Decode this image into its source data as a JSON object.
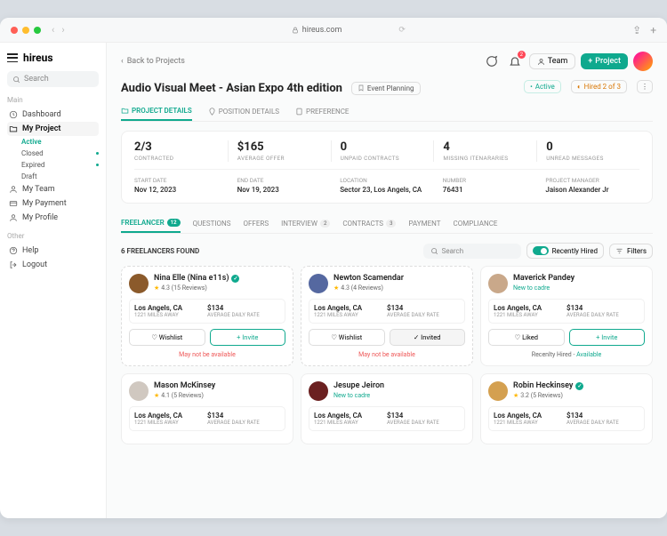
{
  "browser": {
    "url": "hireus.com"
  },
  "brand": "hireus",
  "search_placeholder": "Search",
  "nav": {
    "main_label": "Main",
    "dashboard": "Dashboard",
    "my_project": "My Project",
    "sub": {
      "active": "Active",
      "closed": "Closed",
      "expired": "Expired",
      "draft": "Draft"
    },
    "my_team": "My Team",
    "my_payment": "My Payment",
    "my_profile": "My Profile",
    "other_label": "Other",
    "help": "Help",
    "logout": "Logout"
  },
  "top": {
    "back": "Back to Projects",
    "team": "Team",
    "project": "Project",
    "notif": "2"
  },
  "project": {
    "title": "Audio Visual Meet - Asian Expo 4th edition",
    "category": "Event Planning",
    "status_active": "Active",
    "status_hired": "Hired 2 of 3"
  },
  "tabs": {
    "details": "PROJECT DETAILS",
    "position": "POSITION DETAILS",
    "preference": "PREFERENCE"
  },
  "stats": [
    {
      "v": "2/3",
      "l": "CONTRACTED"
    },
    {
      "v": "$165",
      "l": "AVERAGE OFFER"
    },
    {
      "v": "0",
      "l": "UNPAID CONTRACTS"
    },
    {
      "v": "4",
      "l": "MISSING ITENARARIES"
    },
    {
      "v": "0",
      "l": "UNREAD MESSAGES"
    }
  ],
  "details": [
    {
      "l": "START DATE",
      "v": "Nov 12, 2023"
    },
    {
      "l": "END DATE",
      "v": "Nov 19, 2023"
    },
    {
      "l": "LOCATION",
      "v": "Sector 23, Los Angels, CA"
    },
    {
      "l": "NUMBER",
      "v": "76431"
    },
    {
      "l": "PROJECT MANAGER",
      "v": "Jaison Alexander Jr"
    }
  ],
  "subtabs": {
    "freelancer": {
      "label": "FREELANCER",
      "count": "12"
    },
    "questions": "QUESTIONS",
    "offers": "OFFERS",
    "interview": {
      "label": "INTERVIEW",
      "count": "2"
    },
    "contracts": {
      "label": "CONTRACTS",
      "count": "3"
    },
    "payment": "PAYMENT",
    "compliance": "COMPLIANCE"
  },
  "list": {
    "found": "6 FREELANCERS FOUND",
    "search_placeholder": "Search",
    "recently_hired": "Recently Hired",
    "filters": "Filters"
  },
  "btn": {
    "wishlist": "Wishlist",
    "invite": "Invite",
    "invited": "Invited",
    "liked": "Liked"
  },
  "foot": {
    "warn": "May not be available",
    "recent": "Recenlty Hired - ",
    "avail": "Available"
  },
  "cards": [
    {
      "name": "Nina Elle (Nina e11s)",
      "rating": "4.3 (15 Reviews)",
      "loc": "Los Angels, CA",
      "dist": "1221 MILES AWAY",
      "rate": "$134",
      "ratel": "AVERAGE DAILY RATE",
      "verified": true,
      "color": "#8b5a2b"
    },
    {
      "name": "Newton Scamendar",
      "rating": "4.3 (4 Reviews)",
      "loc": "Los Angels, CA",
      "dist": "1221 MILES AWAY",
      "rate": "$134",
      "ratel": "AVERAGE DAILY RATE",
      "color": "#5568a0"
    },
    {
      "name": "Maverick Pandey",
      "new": "New to cadre",
      "loc": "Los Angels, CA",
      "dist": "1221 MILES AWAY",
      "rate": "$134",
      "ratel": "AVERAGE DAILY RATE",
      "color": "#c9a88a"
    },
    {
      "name": "Mason McKinsey",
      "rating": "4.1 (5 Reviews)",
      "loc": "Los Angels, CA",
      "dist": "1221 MILES AWAY",
      "rate": "$134",
      "ratel": "AVERAGE DAILY RATE",
      "color": "#d0c8c0"
    },
    {
      "name": "Jesupe Jeiron",
      "new": "New to cadre",
      "loc": "Los Angels, CA",
      "dist": "1221 MILES AWAY",
      "rate": "$134",
      "ratel": "AVERAGE DAILY RATE",
      "color": "#6b2020"
    },
    {
      "name": "Robin Heckinsey",
      "rating": "3.2 (5 Reviews)",
      "loc": "Los Angels, CA",
      "dist": "1221 MILES AWAY",
      "rate": "$134",
      "ratel": "AVERAGE DAILY RATE",
      "verified": true,
      "color": "#d4a050"
    }
  ]
}
